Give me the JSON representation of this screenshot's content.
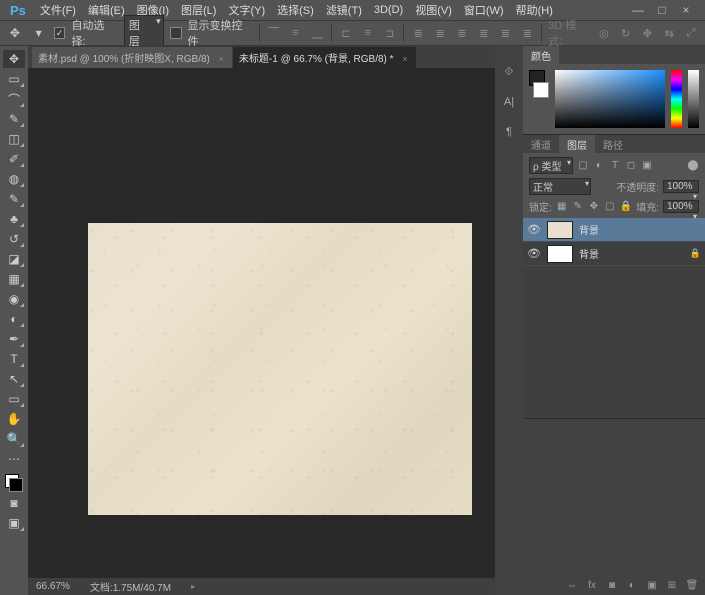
{
  "menubar": {
    "items": [
      "文件(F)",
      "编辑(E)",
      "图像(I)",
      "图层(L)",
      "文字(Y)",
      "选择(S)",
      "滤镜(T)",
      "3D(D)",
      "视图(V)",
      "窗口(W)",
      "帮助(H)"
    ]
  },
  "window_controls": {
    "min": "—",
    "max": "□",
    "close": "×"
  },
  "optionsbar": {
    "auto_select": "自动选择:",
    "target": "图层",
    "show_transform": "显示变换控件",
    "mode_3d": "3D 模式:"
  },
  "tabs": [
    {
      "label": "素材.psd @ 100% (折射映图X, RGB/8)",
      "active": false
    },
    {
      "label": "未标题-1 @ 66.7% (背景, RGB/8) *",
      "active": true
    }
  ],
  "statusbar": {
    "zoom": "66.67%",
    "docinfo": "文档:1.75M/40.7M"
  },
  "panels": {
    "color_tab": "颜色",
    "sub_tabs": [
      "通道",
      "图层",
      "路径"
    ],
    "layers": {
      "kind_label": "ρ 类型",
      "blend_mode": "正常",
      "opacity_label": "不透明度:",
      "opacity_value": "100%",
      "lock_label": "锁定:",
      "fill_label": "填充:",
      "fill_value": "100%",
      "items": [
        {
          "name": "背景",
          "visible": true,
          "locked": false,
          "selected": true,
          "thumb": "texture"
        },
        {
          "name": "背景",
          "visible": true,
          "locked": true,
          "selected": false,
          "thumb": "white"
        }
      ]
    }
  }
}
